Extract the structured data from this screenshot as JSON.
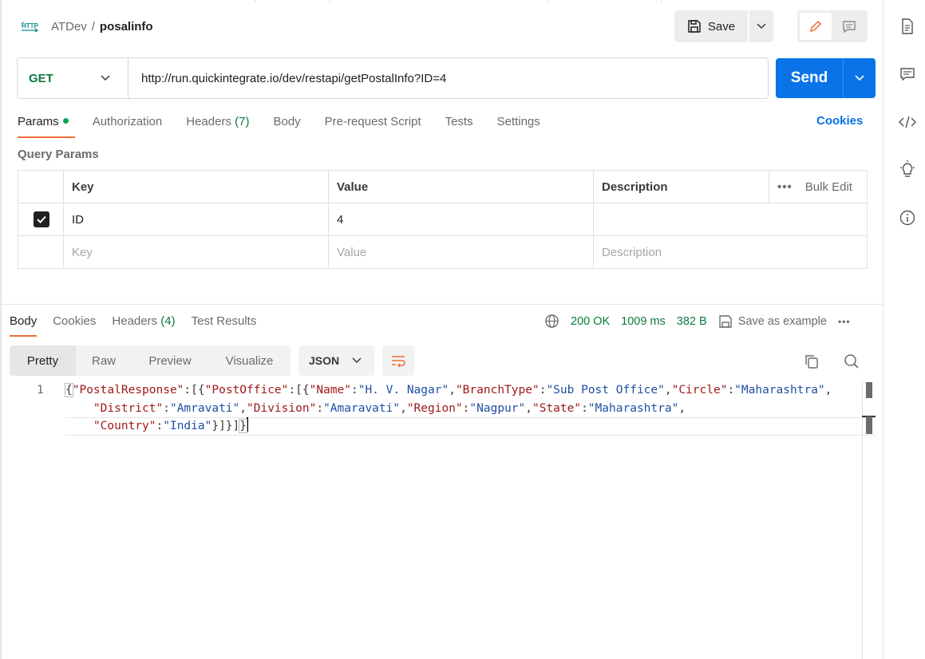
{
  "breadcrumb": {
    "workspace": "ATDev",
    "separator": "/",
    "request": "posalinfo",
    "icon_label": "HTTP"
  },
  "toolbar": {
    "save_label": "Save"
  },
  "request": {
    "method": "GET",
    "url": "http://run.quickintegrate.io/dev/restapi/getPostalInfo?ID=4",
    "send_label": "Send"
  },
  "request_tabs": [
    {
      "label": "Params"
    },
    {
      "label": "Authorization"
    },
    {
      "label": "Headers",
      "count": "(7)"
    },
    {
      "label": "Body"
    },
    {
      "label": "Pre-request Script"
    },
    {
      "label": "Tests"
    },
    {
      "label": "Settings"
    }
  ],
  "cookies_label": "Cookies",
  "query_params": {
    "title": "Query Params",
    "headers": {
      "key": "Key",
      "value": "Value",
      "description": "Description",
      "bulk_edit": "Bulk Edit"
    },
    "rows": [
      {
        "key": "ID",
        "value": "4",
        "checked": true
      }
    ],
    "placeholders": {
      "key": "Key",
      "value": "Value",
      "description": "Description"
    }
  },
  "response_tabs": [
    {
      "label": "Body"
    },
    {
      "label": "Cookies"
    },
    {
      "label": "Headers",
      "count": "(4)"
    },
    {
      "label": "Test Results"
    }
  ],
  "response_meta": {
    "status": "200 OK",
    "time": "1009 ms",
    "size": "382 B",
    "save_example": "Save as example"
  },
  "view_modes": [
    "Pretty",
    "Raw",
    "Preview",
    "Visualize"
  ],
  "format": "JSON",
  "code": {
    "line_number": "1"
  },
  "colors": {
    "accent": "#f26b3a",
    "send": "#0a73e8",
    "success": "#0b7a3e",
    "json_key": "#a01818",
    "json_string": "#1f4fa3"
  },
  "icons": [
    "http-icon",
    "save-icon",
    "pencil-icon",
    "comment-icon",
    "globe-icon",
    "copy-icon",
    "search-icon",
    "wrap-icon",
    "document-icon",
    "code-icon",
    "lightbulb-icon",
    "info-icon"
  ]
}
